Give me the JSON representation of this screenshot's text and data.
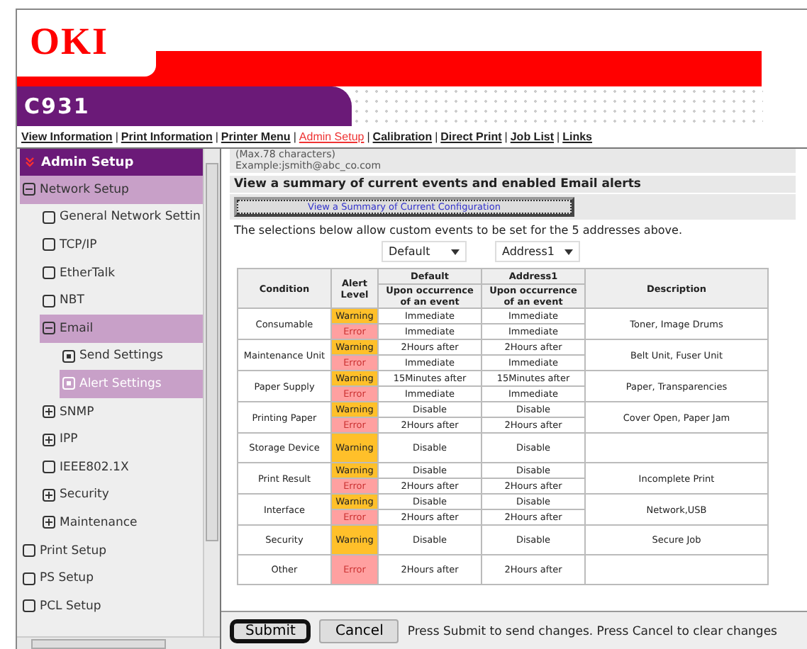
{
  "brand": {
    "logo": "OKI",
    "model": "C931"
  },
  "nav_separator": "|",
  "nav": [
    {
      "label": "View Information",
      "selected": false
    },
    {
      "label": "Print Information",
      "selected": false
    },
    {
      "label": "Printer Menu",
      "selected": false
    },
    {
      "label": "Admin Setup",
      "selected": true
    },
    {
      "label": "Calibration",
      "selected": false
    },
    {
      "label": "Direct Print",
      "selected": false
    },
    {
      "label": "Job List",
      "selected": false
    },
    {
      "label": "Links",
      "selected": false
    }
  ],
  "sidebar": {
    "title": "Admin Setup",
    "items": [
      {
        "label": "Network Setup",
        "kind": "group",
        "expanded": true,
        "selected": false,
        "children": [
          {
            "label": "General Network Settin",
            "kind": "leaf",
            "selected": false
          },
          {
            "label": "TCP/IP",
            "kind": "leaf",
            "selected": false
          },
          {
            "label": "EtherTalk",
            "kind": "leaf",
            "selected": false
          },
          {
            "label": "NBT",
            "kind": "leaf",
            "selected": false
          },
          {
            "label": "Email",
            "kind": "group",
            "expanded": true,
            "selected": false,
            "children": [
              {
                "label": "Send Settings",
                "kind": "page",
                "selected": false
              },
              {
                "label": "Alert Settings",
                "kind": "page",
                "selected": true
              }
            ]
          },
          {
            "label": "SNMP",
            "kind": "group",
            "expanded": false,
            "selected": false
          },
          {
            "label": "IPP",
            "kind": "group",
            "expanded": false,
            "selected": false
          },
          {
            "label": "IEEE802.1X",
            "kind": "leaf",
            "selected": false
          },
          {
            "label": "Security",
            "kind": "group",
            "expanded": false,
            "selected": false
          },
          {
            "label": "Maintenance",
            "kind": "group",
            "expanded": false,
            "selected": false
          }
        ]
      },
      {
        "label": "Print Setup",
        "kind": "leaf",
        "selected": false
      },
      {
        "label": "PS Setup",
        "kind": "leaf",
        "selected": false
      },
      {
        "label": "PCL Setup",
        "kind": "leaf",
        "selected": false
      }
    ]
  },
  "content": {
    "hint_lines": [
      "(Max.78 characters)",
      "Example:jsmith@abc_co.com"
    ],
    "summary_heading": "View a summary of current events and enabled Email alerts",
    "summary_button": "View  a Summary of Current Configuration",
    "intro": "The selections below allow custom events to be set for the 5 addresses above.",
    "selects": [
      {
        "value": "Default"
      },
      {
        "value": "Address1"
      }
    ],
    "table": {
      "columns": {
        "condition": "Condition",
        "alert_level": "Alert Level",
        "default": "Default",
        "address1": "Address1",
        "default_sub": "Upon occurrence of an event",
        "address1_sub": "Upon occurrence of an event",
        "description": "Description"
      },
      "rows": [
        {
          "condition": "Consumable",
          "description": "Toner, Image Drums",
          "alerts": [
            {
              "kind": "warning",
              "label": "Warning",
              "default": "Immediate",
              "address1": "Immediate"
            },
            {
              "kind": "error",
              "label": "Error",
              "default": "Immediate",
              "address1": "Immediate"
            }
          ]
        },
        {
          "condition": "Maintenance Unit",
          "description": "Belt Unit, Fuser Unit",
          "alerts": [
            {
              "kind": "warning",
              "label": "Warning",
              "default": "2Hours after",
              "address1": "2Hours after"
            },
            {
              "kind": "error",
              "label": "Error",
              "default": "Immediate",
              "address1": "Immediate"
            }
          ]
        },
        {
          "condition": "Paper Supply",
          "description": "Paper, Transparencies",
          "alerts": [
            {
              "kind": "warning",
              "label": "Warning",
              "default": "15Minutes after",
              "address1": "15Minutes after"
            },
            {
              "kind": "error",
              "label": "Error",
              "default": "Immediate",
              "address1": "Immediate"
            }
          ]
        },
        {
          "condition": "Printing Paper",
          "description": "Cover Open, Paper Jam",
          "alerts": [
            {
              "kind": "warning",
              "label": "Warning",
              "default": "Disable",
              "address1": "Disable"
            },
            {
              "kind": "error",
              "label": "Error",
              "default": "2Hours after",
              "address1": "2Hours after"
            }
          ]
        },
        {
          "condition": "Storage Device",
          "alerts": [
            {
              "kind": "warning",
              "label": "Warning",
              "default": "Disable",
              "address1": "Disable"
            }
          ]
        },
        {
          "condition": "Print Result",
          "description": "Incomplete Print",
          "alerts": [
            {
              "kind": "warning",
              "label": "Warning",
              "default": "Disable",
              "address1": "Disable"
            },
            {
              "kind": "error",
              "label": "Error",
              "default": "2Hours after",
              "address1": "2Hours after"
            }
          ]
        },
        {
          "condition": "Interface",
          "description": "Network,USB",
          "alerts": [
            {
              "kind": "warning",
              "label": "Warning",
              "default": "Disable",
              "address1": "Disable"
            },
            {
              "kind": "error",
              "label": "Error",
              "default": "2Hours after",
              "address1": "2Hours after"
            }
          ]
        },
        {
          "condition": "Security",
          "description": "Secure Job",
          "alerts": [
            {
              "kind": "warning",
              "label": "Warning",
              "default": "Disable",
              "address1": "Disable"
            }
          ]
        },
        {
          "condition": "Other",
          "alerts": [
            {
              "kind": "error",
              "label": "Error",
              "default": "2Hours after",
              "address1": "2Hours after"
            }
          ]
        }
      ]
    }
  },
  "footer": {
    "buttons": [
      {
        "label": "Submit",
        "focused": true
      },
      {
        "label": "Cancel",
        "focused": false
      }
    ],
    "note": "Press Submit to send changes. Press Cancel to clear changes"
  }
}
